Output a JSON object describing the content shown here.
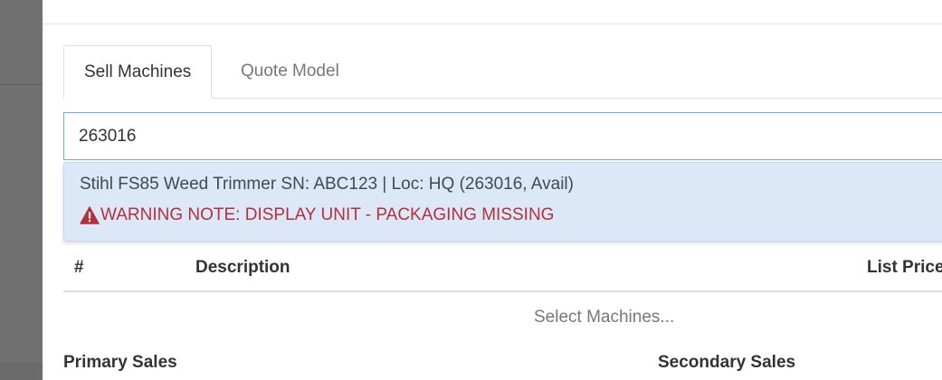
{
  "tabs": [
    {
      "label": "Sell Machines",
      "active": true
    },
    {
      "label": "Quote Model",
      "active": false
    }
  ],
  "search": {
    "value": "263016"
  },
  "results": [
    {
      "title": "Stihl FS85 Weed Trimmer SN: ABC123 | Loc: HQ (263016, Avail)",
      "warning": "WARNING NOTE: DISPLAY UNIT - PACKAGING MISSING",
      "warning_icon": "exclamation-triangle-icon"
    }
  ],
  "table": {
    "headers": [
      "#",
      "Description",
      "List Price"
    ],
    "empty_message": "Select Machines..."
  },
  "below_labels": [
    "Primary Sales",
    "Secondary Sales"
  ],
  "colors": {
    "accent_border": "#66afe9",
    "highlight_bg": "#dce8f8",
    "warning_text": "#b3313a"
  }
}
